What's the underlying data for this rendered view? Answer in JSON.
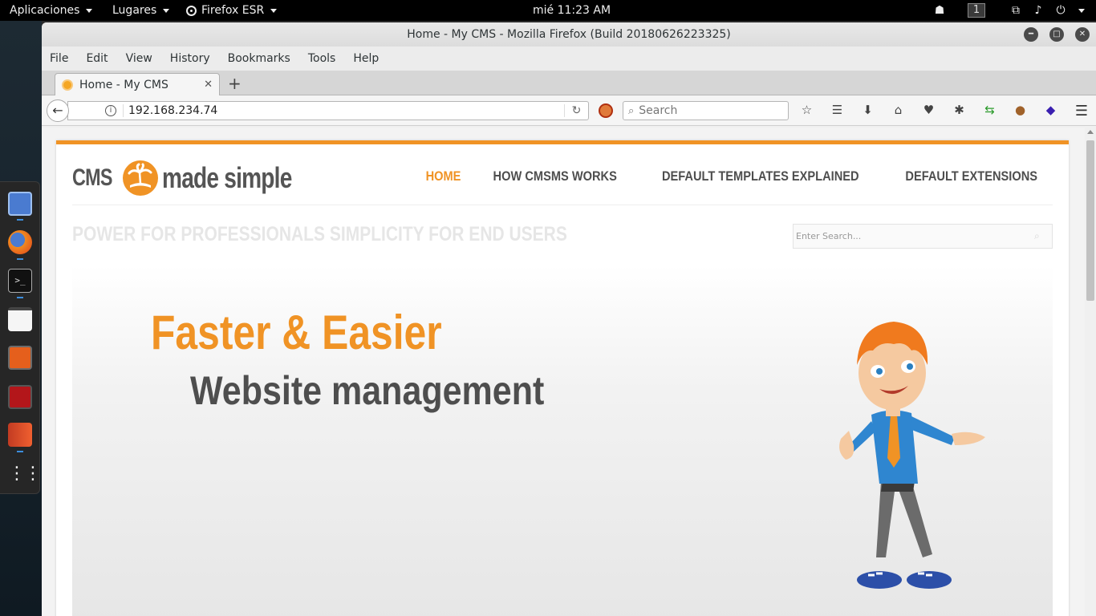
{
  "topbar": {
    "activities": "Aplicaciones",
    "places": "Lugares",
    "app_menu": "Firefox ESR",
    "clock": "mié 11:23 AM",
    "workspace": "1",
    "tray_icons": [
      "users-icon",
      "network-icon",
      "volume-muted-icon",
      "power-icon"
    ]
  },
  "dock": {
    "apps": [
      "files-icon",
      "firefox-icon",
      "terminal-icon",
      "text-editor-icon",
      "burpsuite-icon",
      "metasploit-icon",
      "zaproxy-icon",
      "show-apps-icon"
    ]
  },
  "window": {
    "title": "Home - My CMS - Mozilla Firefox (Build 20180626223325)"
  },
  "menubar": {
    "items": [
      "File",
      "Edit",
      "View",
      "History",
      "Bookmarks",
      "Tools",
      "Help"
    ]
  },
  "tabs": [
    {
      "title": "Home - My CMS",
      "active": true
    }
  ],
  "navbar": {
    "url": "192.168.234.74",
    "search_placeholder": "Search"
  },
  "site": {
    "logo_text": [
      "CMS",
      "made simple"
    ],
    "nav": [
      "HOME",
      "HOW CMSMS WORKS",
      "DEFAULT TEMPLATES EXPLAINED",
      "DEFAULT EXTENSIONS"
    ],
    "nav_active": "HOME",
    "tagline": "POWER FOR PROFESSIONALS SIMPLICITY FOR END USERS",
    "search_placeholder": "Enter Search...",
    "hero": {
      "headline": "Faster & Easier",
      "subheadline": "Website management"
    },
    "colors": {
      "accent": "#f09325",
      "text_dark": "#4e4e4e"
    }
  }
}
